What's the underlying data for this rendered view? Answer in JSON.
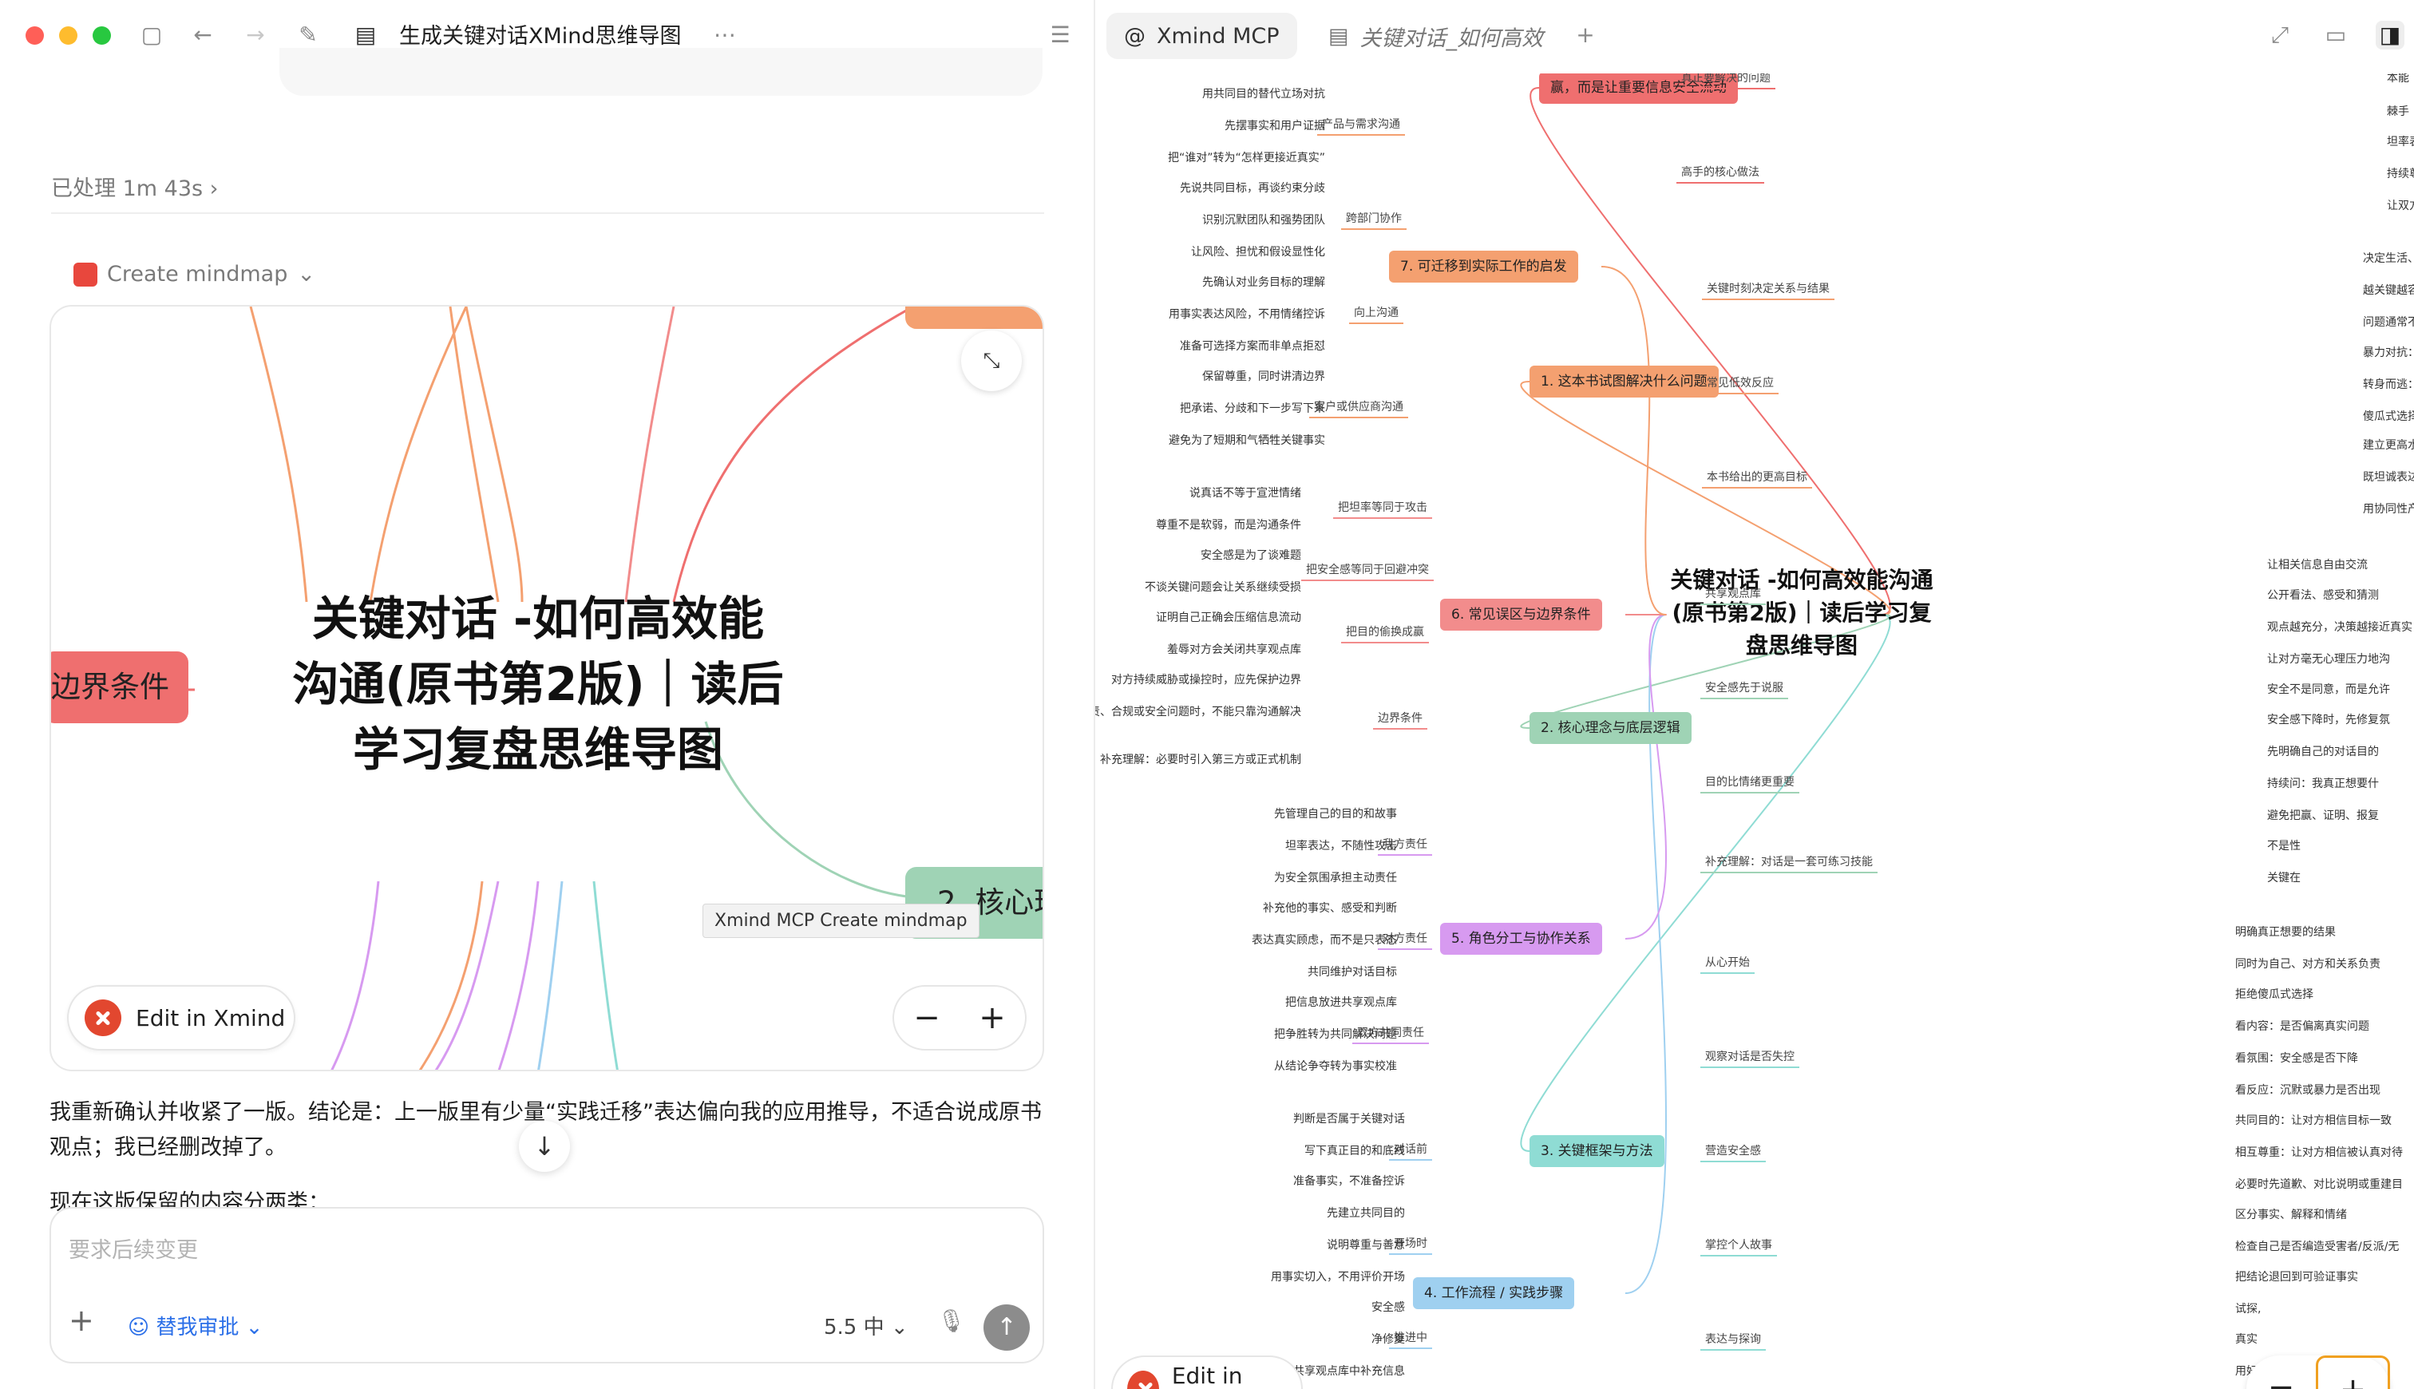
{
  "window": {
    "title": "生成关键对话XMind思维导图",
    "more": "⋯"
  },
  "left": {
    "processed": "已处理 1m 43s",
    "create_mindmap": "Create mindmap",
    "card": {
      "title": "关键对话 -如何高效能沟通(原书第2版)｜读后学习复盘思维导图",
      "pink_node": "边界条件",
      "green_node": "2. 核心理",
      "edit_label": "Edit in Xmind",
      "tooltip": "Xmind MCP Create mindmap"
    },
    "message": "我重新确认并收紧了一版。结论是：上一版里有少量“实践迁移”表达偏向我的应用推导，不适合说成原书观点；我已经删改掉了。",
    "message2": "现在这版保留的内容分两类：",
    "composer": {
      "placeholder": "要求后续变更",
      "mode": "替我审批",
      "model": "5.5 中"
    }
  },
  "right": {
    "tabs": [
      {
        "label": "Xmind MCP"
      },
      {
        "label": "关键对话_如何高效"
      }
    ],
    "center": "关键对话 -如何高效能沟通(原书第2版)｜读后学习复盘思维导图",
    "edit_label": "Edit in Xmind",
    "branches": {
      "b0": "赢，而是让重要信息安全流动",
      "b1": "1. 这本书试图解决什么问题",
      "b2": "2. 核心理念与底层逻辑",
      "b3": "3. 关键框架与方法",
      "b4": "4. 工作流程 / 实践步骤",
      "b5": "5. 角色分工与协作关系",
      "b6": "6. 常见误区与边界条件",
      "b7": "7. 可迁移到实际工作的启发"
    },
    "sub": {
      "r0a": "真正要解决的问题",
      "r0b": "高手的核心做法",
      "r1a": "关键时刻决定关系与结果",
      "r1b": "常见低效反应",
      "r1c": "本书给出的更高目标",
      "r2a": "共享观点库",
      "r2b": "安全感先于说服",
      "r2c": "目的比情绪更重要",
      "r2d": "补充理解：对话是一套可练习技能",
      "r3a": "从心开始",
      "r3b": "观察对话是否失控",
      "r3c": "营造安全感",
      "r3d": "掌控个人故事",
      "r3e": "表达与探询",
      "l7a": "产品与需求沟通",
      "l7b": "跨部门协作",
      "l7c": "向上沟通",
      "l7d": "客户或供应商沟通",
      "l6a": "把坦率等同于攻击",
      "l6b": "把安全感等同于回避冲突",
      "l6c": "把目的偷换成赢",
      "l6d": "边界条件",
      "l5a": "我方责任",
      "l5b": "对方责任",
      "l5c": "双方共同责任",
      "l4a": "对话前",
      "l4b": "开场时",
      "l4c": "推进中"
    },
    "leaves": {
      "r0": [
        "本能",
        "棘手",
        "坦率表",
        "持续尊",
        "让双方"
      ],
      "r1": [
        "决定生活、",
        "越关键越容",
        "问题通常不",
        "暴力对抗：压服、讽刺",
        "转身而逃：回避、沉默",
        "傻瓜式选择：要么说",
        "建立更高水平的",
        "既坦诚表达，也",
        "用协同性产生更"
      ],
      "r2": [
        "让相关信息自由交流",
        "公开看法、感受和猜测",
        "观点越充分，决策越接近真实",
        "让对方毫无心理压力地沟",
        "安全不是同意，而是允许",
        "安全感下降时，先修复氛",
        "先明确自己的对话目的",
        "持续问：我真正想要什",
        "避免把赢、证明、报复",
        "不是性",
        "关键在"
      ],
      "r3": [
        "明确真正想要的结果",
        "同时为自己、对方和关系负责",
        "拒绝傻瓜式选择",
        "看内容：是否偏离真实问题",
        "看氛围：安全感是否下降",
        "看反应：沉默或暴力是否出现",
        "共同目的：让对方相信目标一致",
        "相互尊重：让对方相信被认真对待",
        "必要时先道歉、对比说明或重建目",
        "区分事实、解释和情绪",
        "检查自己是否编造受害者/反派/无",
        "把结论退回到可验证事实",
        "用好奇心探索对方路径",
        "试探,",
        "真实"
      ],
      "l7": [
        "用共同目的替代立场对抗",
        "先摆事实和用户证据",
        "把“谁对”转为“怎样更接近真实”",
        "先说共同目标，再谈约束分歧",
        "识别沉默团队和强势团队",
        "让风险、担忧和假设显性化",
        "先确认对业务目标的理解",
        "用事实表达风险，不用情绪控诉",
        "准备可选择方案而非单点拒怼",
        "保留尊重，同时讲清边界",
        "把承诺、分歧和下一步写下来",
        "避免为了短期和气牺牲关键事实"
      ],
      "l6": [
        "说真话不等于宣泄情绪",
        "尊重不是软弱，而是沟通条件",
        "安全感是为了谈难题",
        "不谈关键问题会让关系继续受损",
        "证明自己正确会压缩信息流动",
        "羞辱对方会关闭共享观点库",
        "对方持续威胁或操控时，应先保护边界",
        "涉及权责、合规或安全问题时，不能只靠沟通解决",
        "补充理解：必要时引入第三方或正式机制"
      ],
      "l5": [
        "先管理自己的目的和故事",
        "坦率表达，不随性攻击",
        "为安全氛围承担主动责任",
        "补充他的事实、感受和判断",
        "表达真实顾虑，而不是只表态",
        "共同维护对话目标",
        "把信息放进共享观点库",
        "把争胜转为共同解决问题",
        "从结论争夺转为事实校准"
      ],
      "l4": [
        "判断是否属于关键对话",
        "写下真正目的和底线",
        "准备事实，不准备控诉",
        "先建立共同目的",
        "说明尊重与善意",
        "用事实切入，不用评价开场",
        "安全感",
        "净修复",
        "在共享观点库中补充信息"
      ]
    }
  },
  "colors": {
    "orange": "#f4a070",
    "red": "#ef6f6f",
    "green": "#9fd3b5",
    "teal": "#8fdcd4",
    "blue": "#9fd0f0",
    "purple": "#d79af0",
    "pink": "#f28c8c"
  }
}
